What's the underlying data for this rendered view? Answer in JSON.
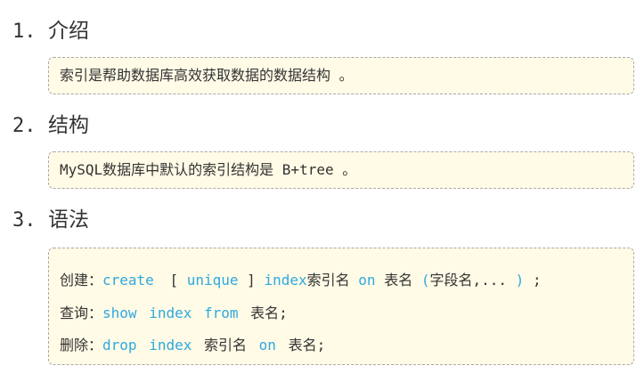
{
  "sections": [
    {
      "number": "1.",
      "title": "介绍",
      "content": "索引是帮助数据库高效获取数据的数据结构 。"
    },
    {
      "number": "2.",
      "title": "结构",
      "content": "MySQL数据库中默认的索引结构是 B+tree 。"
    },
    {
      "number": "3.",
      "title": "语法",
      "lines": {
        "create": {
          "label": "创建：",
          "kw_create": "create",
          "bracket_open": "[",
          "kw_unique": "unique",
          "bracket_close": "]",
          "kw_index": "index",
          "index_name": "索引名",
          "kw_on": "on",
          "table_name": "表名",
          "paren_open": "(",
          "fields": "字段名,... ",
          "paren_close": ")",
          "semicolon": ";"
        },
        "show": {
          "label": "查询：",
          "kw_show": "show",
          "kw_index": "index",
          "kw_from": "from",
          "table_name": "表名;"
        },
        "drop": {
          "label": "删除：",
          "kw_drop": "drop",
          "kw_index": "index",
          "index_name": "索引名",
          "kw_on": "on",
          "table_name": "表名;"
        }
      }
    }
  ]
}
